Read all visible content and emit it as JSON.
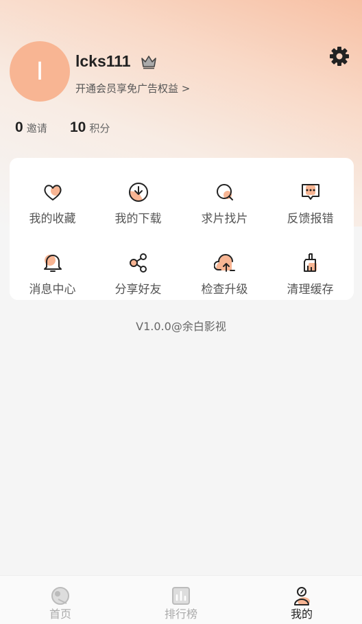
{
  "profile": {
    "avatar_letter": "I",
    "username": "lcks111",
    "vip_link": "开通会员享免广告权益 >"
  },
  "stats": [
    {
      "value": "0",
      "label": "邀请"
    },
    {
      "value": "10",
      "label": "积分"
    }
  ],
  "menu": [
    {
      "label": "我的收藏",
      "icon": "heart-icon"
    },
    {
      "label": "我的下载",
      "icon": "download-icon"
    },
    {
      "label": "求片找片",
      "icon": "search-icon"
    },
    {
      "label": "反馈报错",
      "icon": "feedback-icon"
    },
    {
      "label": "消息中心",
      "icon": "bell-icon"
    },
    {
      "label": "分享好友",
      "icon": "share-icon"
    },
    {
      "label": "检查升级",
      "icon": "cloud-upload-icon"
    },
    {
      "label": "清理缓存",
      "icon": "broom-icon"
    }
  ],
  "version": "V1.0.0@余白影视",
  "tabs": [
    {
      "label": "首页",
      "icon": "home-icon"
    },
    {
      "label": "排行榜",
      "icon": "ranking-icon"
    },
    {
      "label": "我的",
      "icon": "profile-icon",
      "active": true
    }
  ],
  "colors": {
    "accent": "#f8b593",
    "icon_stroke": "#222222",
    "background": "#f5f5f5"
  }
}
